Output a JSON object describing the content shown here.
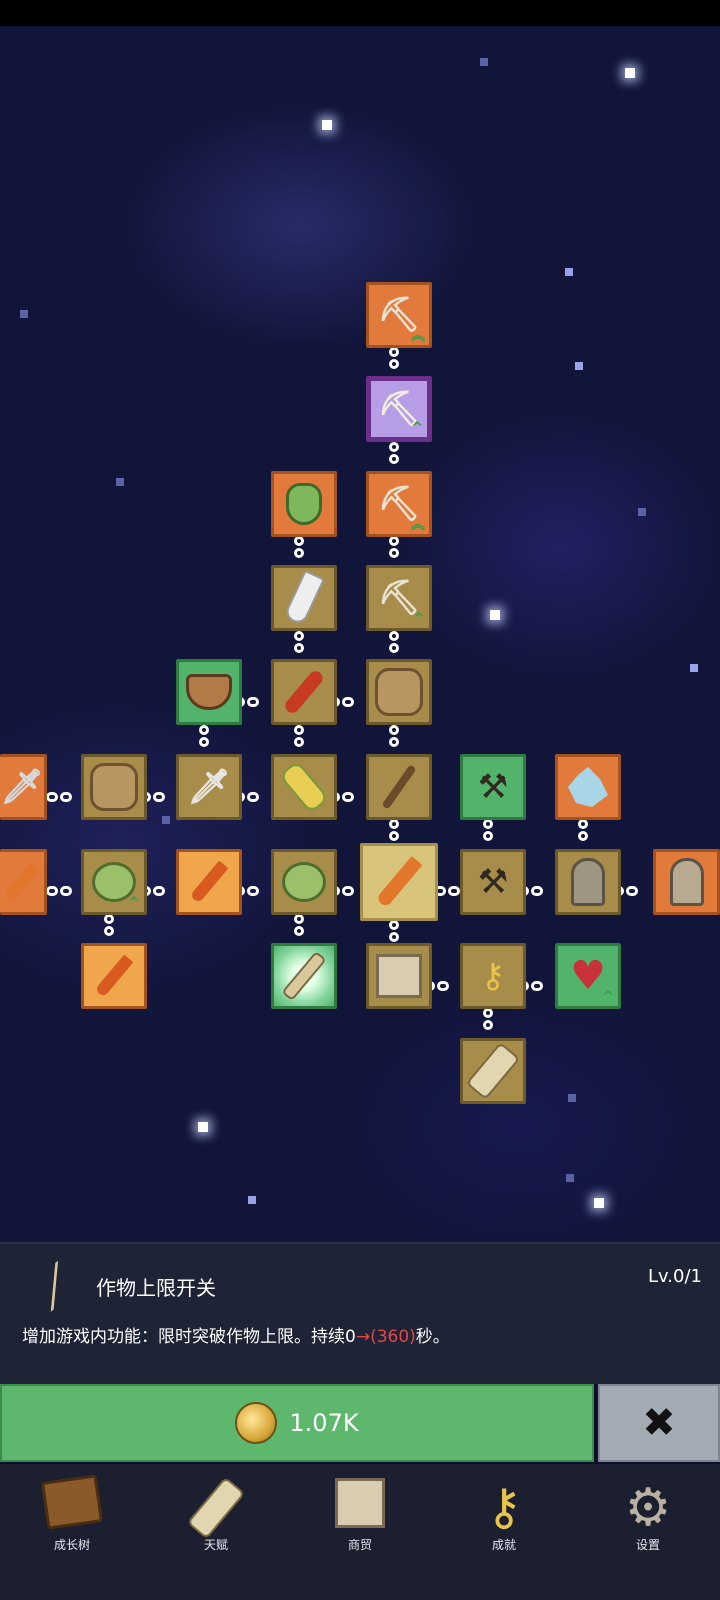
{
  "panel": {
    "title": "作物上限开关",
    "level": "Lv.0/1",
    "desc_prefix": "增加游戏内功能：限时突破作物上限。持续0",
    "desc_change": "→(360)",
    "desc_suffix": "秒。"
  },
  "buy": {
    "cost": "1.07K"
  },
  "close": {
    "glyph": "✖"
  },
  "nav": {
    "items": [
      {
        "label": "成长树",
        "icon": "book-icon"
      },
      {
        "label": "天赋",
        "icon": "scroll-icon"
      },
      {
        "label": "商贸",
        "icon": "map-icon"
      },
      {
        "label": "成就",
        "icon": "key-icon"
      },
      {
        "label": "设置",
        "icon": "gear-icon"
      }
    ]
  },
  "nodes": {
    "shovel_1": "shovel-icon",
    "shovel_2": "shovel-icon",
    "shovel_3": "shovel-icon",
    "shovel_4": "shovel-icon",
    "pepper": "green-pepper-icon",
    "radish": "white-radish-icon",
    "bowl": "bowl-icon",
    "chili": "chili-icon",
    "backpack_1": "backpack-icon",
    "sword_left": "sword-icon",
    "backpack_2": "backpack-icon",
    "sword": "sword-icon",
    "corn": "corn-icon",
    "stick": "stick-icon",
    "pickaxe_green": "pickaxe-icon",
    "crystal": "crystal-icon",
    "carrot_left": "carrot-icon",
    "cabbage_1": "cabbage-icon",
    "carrot_mid": "carrot-icon",
    "cabbage_2": "cabbage-icon",
    "carrot_selected": "carrot-icon",
    "pickaxe": "pickaxe-icon",
    "statue_1": "statue-icon",
    "statue_2": "statue-icon",
    "carrot_bottom": "carrot-icon",
    "crop_switch": "crop-switch-icon",
    "map": "map-icon",
    "key": "key-icon",
    "heart": "heart-icon",
    "scroll": "scroll-icon"
  }
}
